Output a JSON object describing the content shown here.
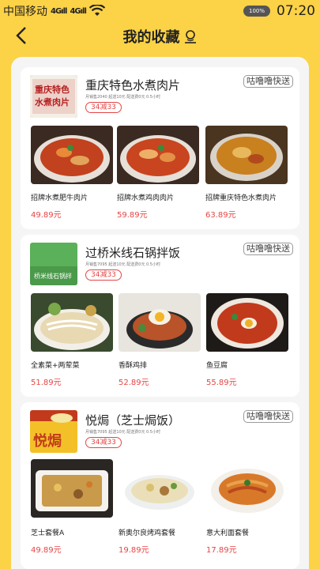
{
  "status": {
    "carrier": "中国移动",
    "signal1": "4Gıll",
    "signal2": "4Gıll",
    "battery": "100%",
    "time": "07:20"
  },
  "nav": {
    "back": "‹",
    "title": "我的收藏"
  },
  "shops": [
    {
      "name": "重庆特色水煮肉片",
      "logo_text": "重庆特色水煮肉片",
      "meta": "月销售2040  起送10元  配送费0元  0.5小时",
      "discount": "34减33",
      "delivery": "咕噜噜快送",
      "dishes": [
        {
          "name": "招牌水煮肥牛肉片",
          "price": "49.89元"
        },
        {
          "name": "招牌水煮鸡肉肉片",
          "price": "59.89元"
        },
        {
          "name": "招牌重庆特色水煮肉片",
          "price": "63.89元"
        }
      ]
    },
    {
      "name": "过桥米线石锅拌饭",
      "logo_text": "桥米线石锅拌",
      "meta": "月销售7095  起送10元  配送费0元  0.5小时",
      "discount": "34减33",
      "delivery": "咕噜噜快送",
      "dishes": [
        {
          "name": "全素菜+两荤菜",
          "price": "51.89元"
        },
        {
          "name": "香酥鸡排",
          "price": "52.89元"
        },
        {
          "name": "鱼豆腐",
          "price": "55.89元"
        }
      ]
    },
    {
      "name": "悦焗（芝士焗饭）",
      "logo_text": "悦焗",
      "meta": "月销售7095  起送10元  配送费0元  0.5小时",
      "discount": "34减33",
      "delivery": "咕噜噜快送",
      "dishes": [
        {
          "name": "芝士套餐A",
          "price": "49.89元"
        },
        {
          "name": "新奥尔良烤鸡套餐",
          "price": "19.89元"
        },
        {
          "name": "意大利面套餐",
          "price": "17.89元"
        }
      ]
    }
  ],
  "colors": {
    "background": "#fcd246",
    "price": "#e64545",
    "discount": "#e64545"
  }
}
